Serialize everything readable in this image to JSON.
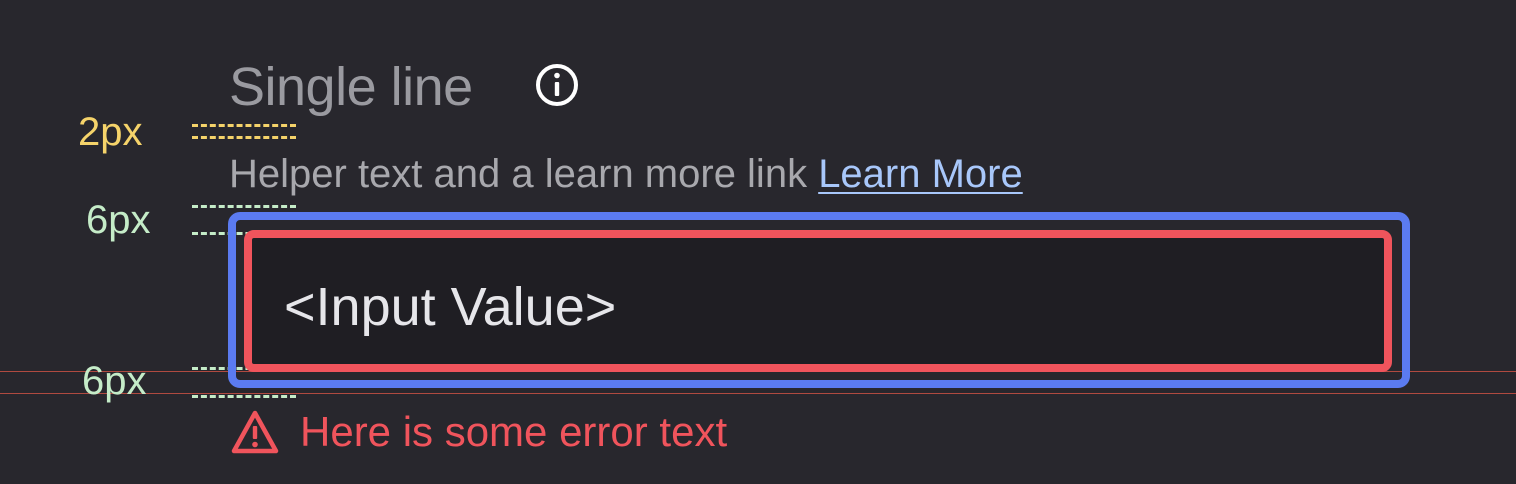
{
  "field": {
    "label": "Single line",
    "info_icon": "info-icon",
    "helper_text": "Helper text and a learn more link ",
    "learn_more_label": "Learn More",
    "input_value": "<Input Value>",
    "error_icon": "warning-icon",
    "error_text": "Here is some error text"
  },
  "spacing_annotations": {
    "label_gap": "2px",
    "helper_gap": "6px",
    "error_gap": "6px"
  },
  "colors": {
    "background": "#28272d",
    "label": "#9a9aa0",
    "helper": "#a8a8ad",
    "link": "#a8c7fa",
    "input_fill": "#1f1e23",
    "input_text": "#e6e6ea",
    "focus_ring": "#5b7bf0",
    "error": "#f0545c",
    "annotation_yellow": "#f5d36a",
    "annotation_green": "#c5ecc8",
    "guide_line": "#b04a40"
  }
}
